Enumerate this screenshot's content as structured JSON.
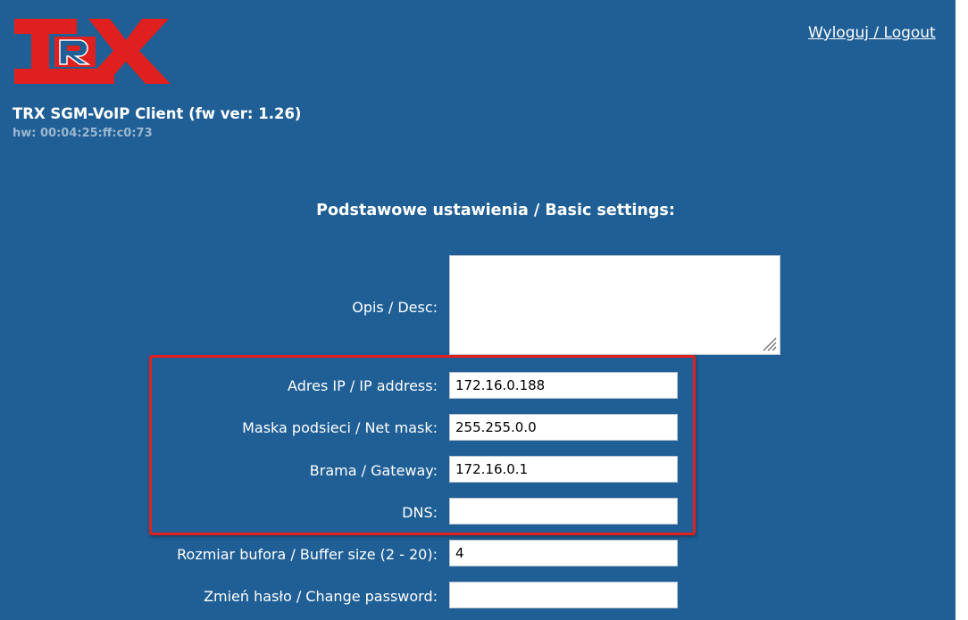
{
  "header": {
    "logout_link": "Wyloguj / Logout",
    "app_title": "TRX SGM-VoIP Client (fw ver: 1.26)",
    "hw_line": "hw: 00:04:25:ff:c0:73",
    "logo_text": "TRX"
  },
  "form": {
    "section_title": "Podstawowe ustawienia / Basic settings:",
    "desc": {
      "label": "Opis / Desc:",
      "value": ""
    },
    "ip_address": {
      "label": "Adres IP / IP address:",
      "value": "172.16.0.188"
    },
    "net_mask": {
      "label": "Maska podsieci / Net mask:",
      "value": "255.255.0.0"
    },
    "gateway": {
      "label": "Brama / Gateway:",
      "value": "172.16.0.1"
    },
    "dns": {
      "label": "DNS:",
      "value": ""
    },
    "buffer_size": {
      "label": "Rozmiar bufora / Buffer size (2 - 20):",
      "value": "4"
    },
    "change_password": {
      "label": "Zmień hasło / Change password:",
      "value": ""
    }
  },
  "colors": {
    "background": "#1f5f95",
    "logo_red": "#e0201f",
    "highlight_border": "#e0201f",
    "hw_text": "#9bb7d0"
  }
}
